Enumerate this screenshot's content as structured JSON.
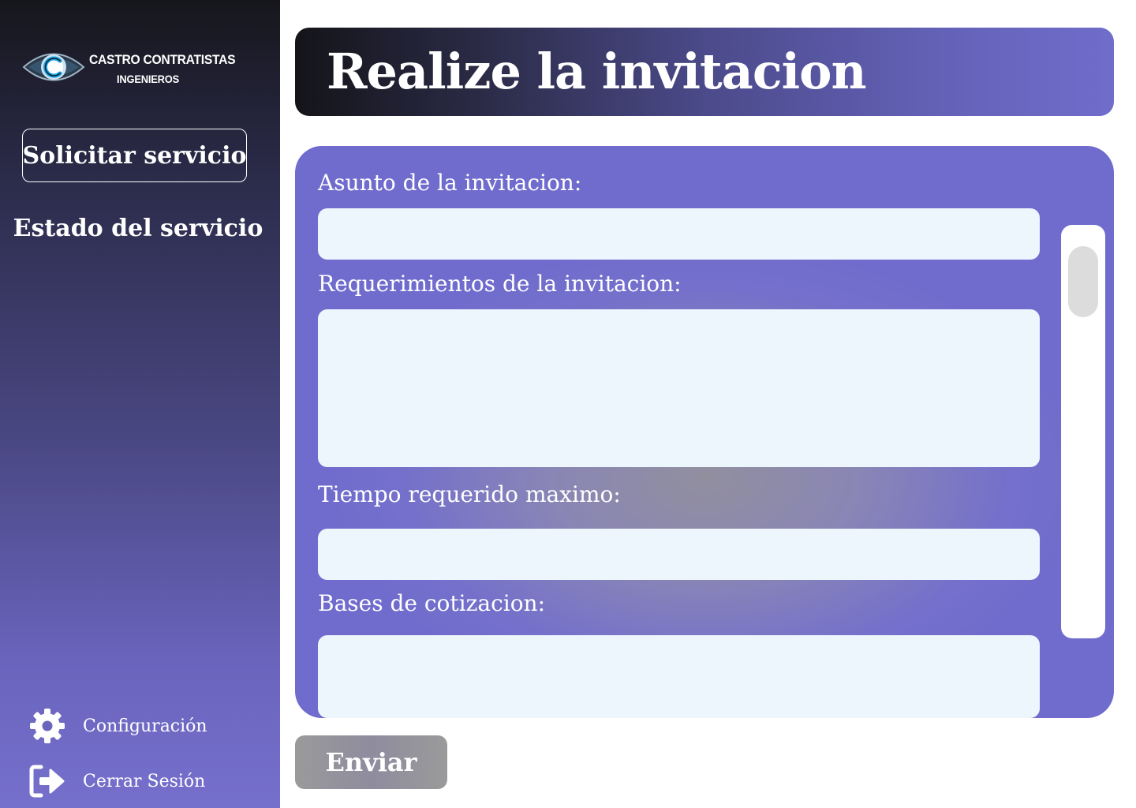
{
  "sidebar": {
    "logo": {
      "line1": "CASTRO CONTRATISTAS",
      "line2": "INGENIEROS",
      "icon": "eye-c-logo-icon"
    },
    "nav": {
      "primary_label": "Solicitar servicio",
      "secondary_label": "Estado del servicio"
    },
    "bottom": {
      "settings_label": "Configuración",
      "settings_icon": "gear-icon",
      "logout_label": "Cerrar Sesión",
      "logout_icon": "logout-icon"
    }
  },
  "header": {
    "title": "Realize la invitacion"
  },
  "form": {
    "subject_label": "Asunto de la invitacion:",
    "subject_value": "",
    "requirements_label": "Requerimientos de la invitacion:",
    "requirements_value": "",
    "time_label": "Tiempo requerido maximo:",
    "time_value": "",
    "bases_label": "Bases de cotizacion:",
    "bases_value": ""
  },
  "actions": {
    "submit_label": "Enviar"
  },
  "colors": {
    "accent": "#706ccd",
    "sidebar_top": "#16161c",
    "field_bg": "#eef6fd",
    "submit_bg": "#9a9a9a"
  }
}
